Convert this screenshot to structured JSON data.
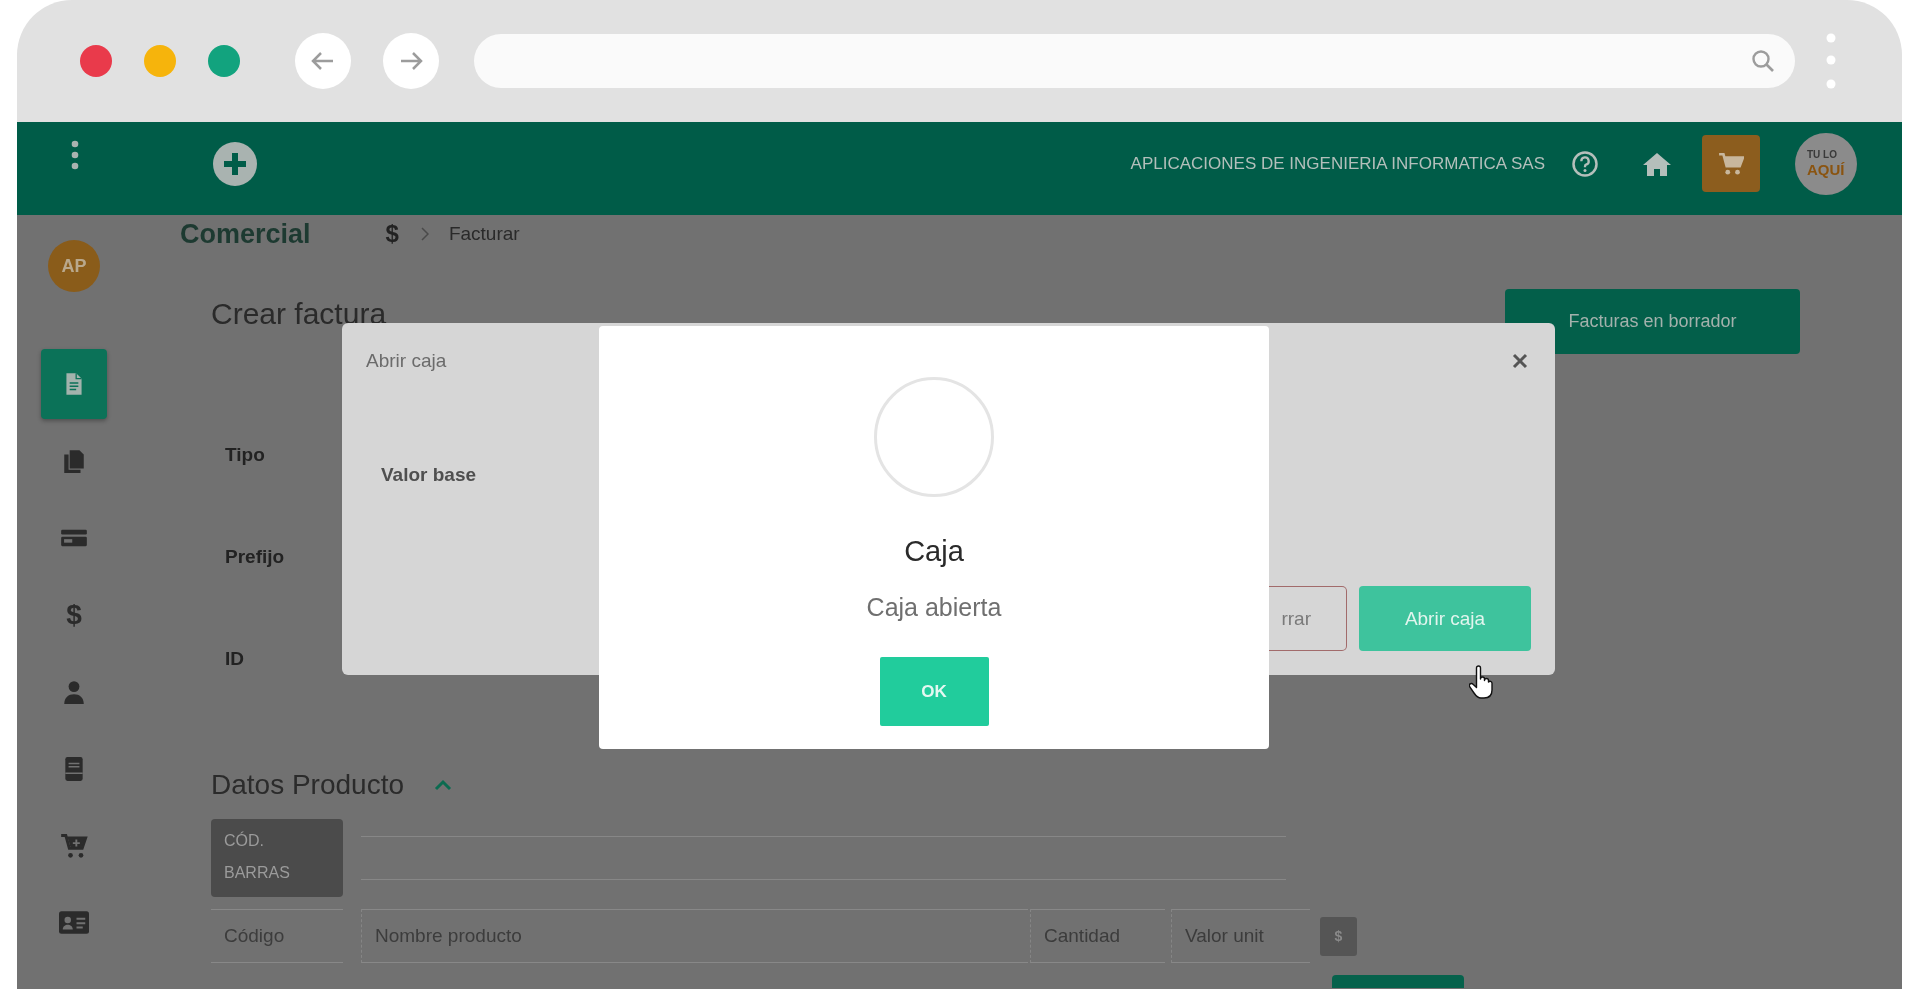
{
  "header": {
    "company": "APLICACIONES DE INGENIERIA INFORMATICA SAS",
    "logo": [
      "TU LO",
      "AQUÍ"
    ]
  },
  "sidebar": {
    "avatar": "AP",
    "items": [
      {
        "selected": true
      },
      {
        "selected": false
      },
      {
        "selected": false
      },
      {
        "glyph": "$",
        "selected": false
      },
      {
        "selected": false
      },
      {
        "selected": false
      },
      {
        "selected": false
      },
      {
        "selected": false
      }
    ]
  },
  "breadcrumb": {
    "module": "Comercial",
    "symbol": "$",
    "page": "Facturar"
  },
  "page": {
    "title": "Crear factura",
    "drafts_button": "Facturas en borrador"
  },
  "form": {
    "labels": [
      "Tipo",
      "Prefijo",
      "ID"
    ]
  },
  "product_section": {
    "title": "Datos Producto",
    "expanded": true,
    "barcode_label": "CÓD. BARRAS",
    "fields": [
      {
        "placeholder": "Código"
      },
      {
        "placeholder": "Nombre producto"
      },
      {
        "placeholder": "Cantidad"
      },
      {
        "placeholder": "Valor unit"
      }
    ],
    "currency_button": "$"
  },
  "open_cash_dialog": {
    "title": "Abrir caja",
    "field_label": "Valor base",
    "buttons": [
      {
        "kind": "outline",
        "label": "rrar"
      },
      {
        "kind": "primary",
        "label": "Abrir caja"
      }
    ]
  },
  "alert": {
    "title": "Caja",
    "message": "Caja abierta",
    "button": "OK"
  }
}
